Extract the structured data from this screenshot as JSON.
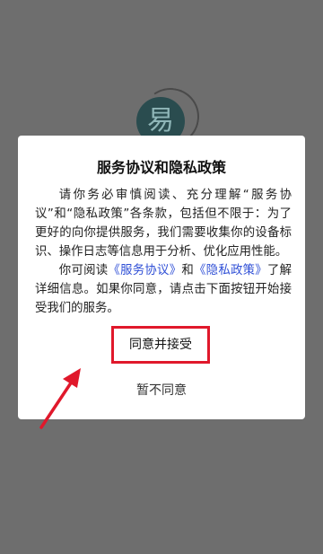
{
  "logo": {
    "glyph": "易"
  },
  "dialog": {
    "title": "服务协议和隐私政策",
    "para1": "请你务必审慎阅读、充分理解“服务协议”和“隐私政策”各条款，包括但不限于：为了更好的向你提供服务，我们需要收集你的设备标识、操作日志等信息用于分析、优化应用性能。",
    "para2_prefix": "你可阅读",
    "service_link": "《服务协议》",
    "and": "和",
    "privacy_link": "《隐私政策》",
    "para2_suffix": "了解详细信息。如果你同意，请点击下面按钮开始接受我们的服务。",
    "agree_label": "同意并接受",
    "decline_label": "暂不同意"
  },
  "colors": {
    "overlay": "#6e6e6e",
    "link": "#2f4fd6",
    "highlight": "#e0182b"
  }
}
